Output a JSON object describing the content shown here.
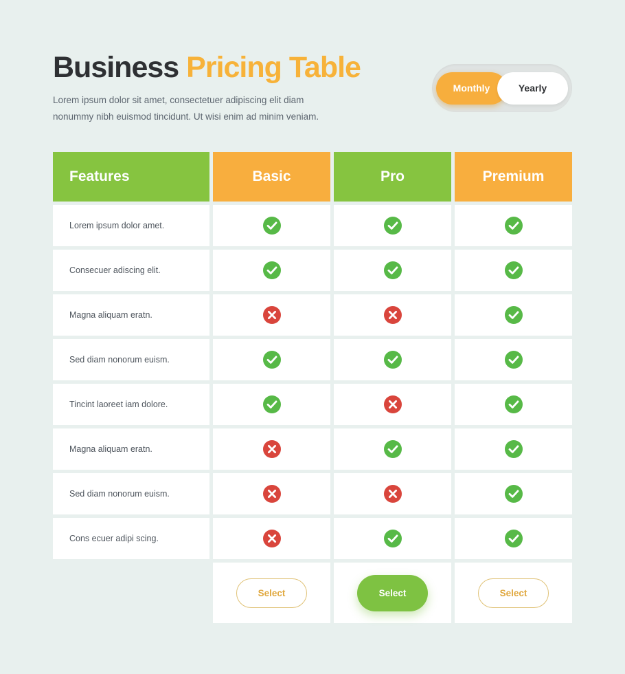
{
  "header": {
    "title_part1": "Business",
    "title_part2": "Pricing Table",
    "subtitle": "Lorem ipsum dolor sit amet, consectetuer adipiscing elit diam nonummy nibh euismod tincidunt. Ut wisi enim ad minim veniam."
  },
  "billing_toggle": {
    "monthly_label": "Monthly",
    "yearly_label": "Yearly",
    "selected": "Monthly"
  },
  "table": {
    "columns": [
      {
        "label": "Features",
        "color": "#86c440"
      },
      {
        "label": "Basic",
        "color": "#f8ae3e"
      },
      {
        "label": "Pro",
        "color": "#86c440"
      },
      {
        "label": "Premium",
        "color": "#f8ae3e"
      }
    ],
    "rows": [
      {
        "feature": "Lorem ipsum dolor amet.",
        "basic": "check",
        "pro": "check",
        "premium": "check"
      },
      {
        "feature": "Consecuer adiscing elit.",
        "basic": "check",
        "pro": "check",
        "premium": "check"
      },
      {
        "feature": "Magna aliquam eratn.",
        "basic": "cross",
        "pro": "cross",
        "premium": "check"
      },
      {
        "feature": "Sed diam nonorum euism.",
        "basic": "check",
        "pro": "check",
        "premium": "check"
      },
      {
        "feature": "Tincint laoreet iam dolore.",
        "basic": "check",
        "pro": "cross",
        "premium": "check"
      },
      {
        "feature": "Magna aliquam eratn.",
        "basic": "cross",
        "pro": "check",
        "premium": "check"
      },
      {
        "feature": "Sed diam nonorum euism.",
        "basic": "cross",
        "pro": "cross",
        "premium": "check"
      },
      {
        "feature": "Cons ecuer adipi scing.",
        "basic": "cross",
        "pro": "check",
        "premium": "check"
      }
    ],
    "actions": [
      {
        "label": "Select",
        "style": "outline"
      },
      {
        "label": "Select",
        "style": "filled"
      },
      {
        "label": "Select",
        "style": "outline"
      }
    ]
  },
  "colors": {
    "background": "#e8f0ee",
    "green": "#86c440",
    "orange": "#f8ae3e",
    "title_dark": "#2e3033",
    "title_accent": "#f7b239",
    "check_green": "#57b947",
    "cross_red": "#d9453c",
    "button_green": "#7ec242",
    "button_outline": "#e0a83f"
  },
  "icons": {
    "check": "check-circle-icon",
    "cross": "cross-circle-icon"
  }
}
